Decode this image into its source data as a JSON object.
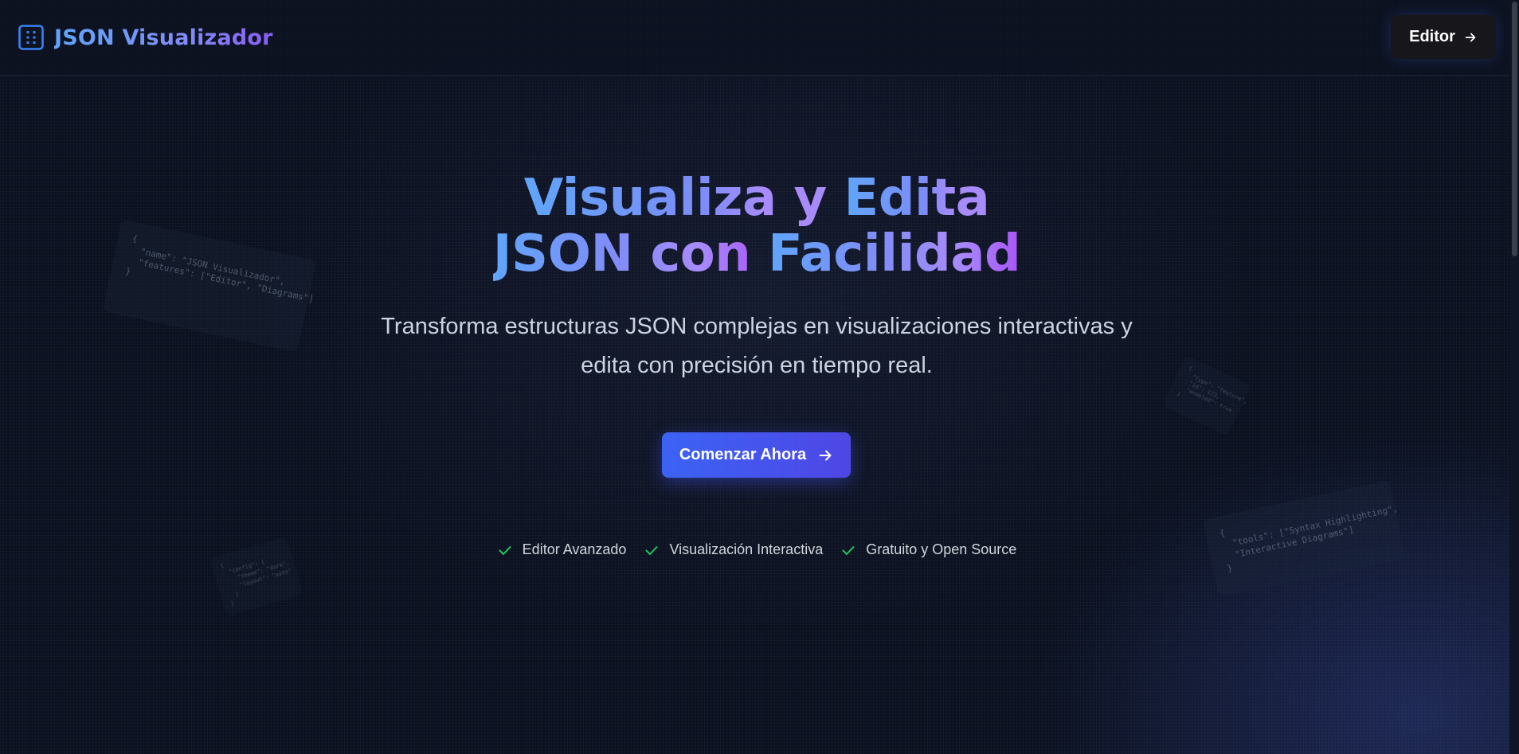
{
  "header": {
    "brand_icon": "layout-grid-icon",
    "brand_title": "JSON Visualizador",
    "editor_button": {
      "label": "Editor",
      "icon": "arrow-right-icon"
    }
  },
  "hero": {
    "title_line1_part1": "Visualiza y ",
    "title_line1_part2": "Edita",
    "title_line2_part1": "JSON con ",
    "title_line2_part2": "Facilidad",
    "subtitle_line1": "Transforma estructuras JSON complejas en visualizaciones interactivas y",
    "subtitle_line2": "edita con precisión en tiempo real.",
    "cta": {
      "label": "Comenzar Ahora",
      "icon": "arrow-right-icon"
    },
    "features": [
      {
        "label": "Editor Avanzado",
        "icon": "check-icon"
      },
      {
        "label": "Visualización Interactiva",
        "icon": "check-icon"
      },
      {
        "label": "Gratuito y Open Source",
        "icon": "check-icon"
      }
    ]
  },
  "floating_code": {
    "card1": "{\n  \"name\": \"JSON Visualizador\",\n  \"features\": [\"Editor\", \"Diagrams\"]\n}",
    "card2": "{\n  \"type\": \"feature\",\n  \"id\": 123,\n  \"enabled\": true\n}",
    "card3": "{\n  \"tools\": [\"Syntax Highlighting\",\n  \"Interactive Diagrams\"]\n}",
    "card4": "{\n  \"config\": {\n    \"theme\": \"dark\",\n    \"layout\": \"auto\"\n  }\n}"
  },
  "colors": {
    "background": "#0b1120",
    "accent_blue": "#60a5fa",
    "accent_purple": "#a855f7",
    "cta": "#4f46e5",
    "check": "#22c55e"
  }
}
